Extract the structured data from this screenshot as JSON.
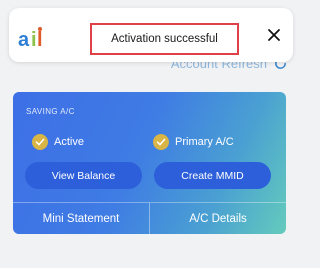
{
  "background": {
    "account_refresh_label": "Account Refresh"
  },
  "toast": {
    "message": "Activation successful",
    "logo_icon": "app-logo-icon",
    "close_icon": "close-icon",
    "highlight_color": "#e04048"
  },
  "card": {
    "account_type": "SAVING A/C",
    "status_active": "Active",
    "status_primary": "Primary A/C",
    "buttons": {
      "view_balance": "View Balance",
      "create_mmid": "Create MMID"
    },
    "footer": {
      "mini_statement": "Mini Statement",
      "ac_details": "A/C Details"
    },
    "colors": {
      "gradient_start": "#3d6fe6",
      "gradient_end": "#64cbbc",
      "check": "#d8b544"
    }
  }
}
